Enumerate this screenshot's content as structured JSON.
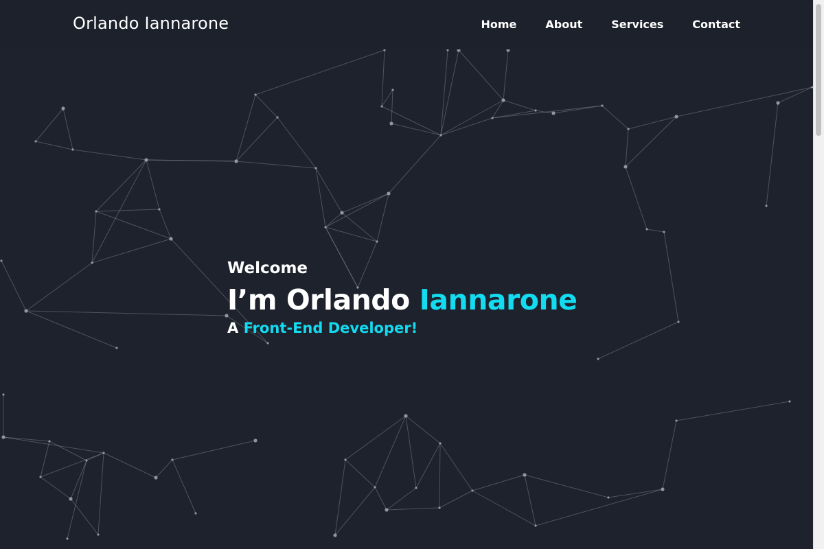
{
  "header": {
    "brand": "Orlando Iannarone",
    "nav": [
      "Home",
      "About",
      "Services",
      "Contact"
    ]
  },
  "hero": {
    "welcome": "Welcome",
    "headline_prefix": "I’m Orlando ",
    "headline_accent": "Iannarone",
    "sub_prefix": "A ",
    "sub_accent": "Front-End Developer!"
  },
  "colors": {
    "background": "#1e222d",
    "accent": "#13dbf0",
    "text": "#ffffff"
  }
}
